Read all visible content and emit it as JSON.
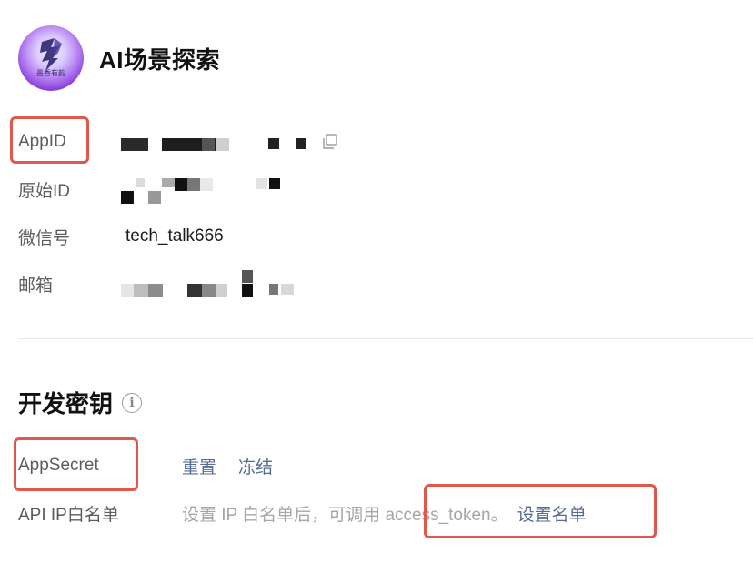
{
  "header": {
    "app_name": "AI场景探索",
    "avatar_caption": "墨香有韵"
  },
  "account_info": {
    "appid_label": "AppID",
    "original_id_label": "原始ID",
    "wechat_label": "微信号",
    "wechat_value": "tech_talk666",
    "email_label": "邮箱"
  },
  "dev_keys": {
    "title": "开发密钥",
    "info_glyph": "i",
    "appsecret_label": "AppSecret",
    "reset_label": "重置",
    "freeze_label": "冻结",
    "ip_whitelist_label": "API IP白名单",
    "ip_hint": "设置 IP 白名单后，可调用 access_token。",
    "set_list_label": "设置名单"
  },
  "colors": {
    "link": "#576b95",
    "highlight": "#e0584d",
    "label": "#5c5c5c",
    "hint": "#a6a6a6"
  }
}
